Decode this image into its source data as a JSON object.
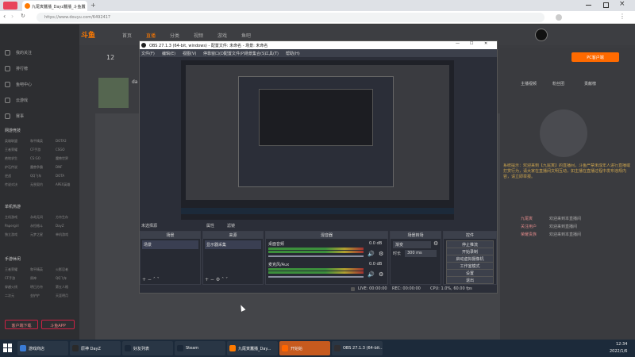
{
  "browser": {
    "tab_title": "九尾寅蠶播_Dayz蠶播_斗鱼蠶",
    "url": "https://www.douyu.com/6492417",
    "new_tab": "+"
  },
  "douyu": {
    "nav": [
      "首页",
      "直播",
      "分类",
      "视频",
      "游戏",
      "鱼吧"
    ],
    "follow_count": "12",
    "streamer_name": "da",
    "sidebar": [
      "我的关注",
      "排行榜",
      "鱼吧中心",
      "云游戏",
      "赛事"
    ],
    "sidebar_section1": "网游竞技",
    "grid1": [
      "英雄联盟",
      "和平精英",
      "DOTA2",
      "王者荣耀",
      "CF手游",
      "CSGO",
      "绝地求生",
      "CS:GO",
      "魔兽世界",
      "炉石传说",
      "魔兽争霸",
      "DNF",
      "逆战",
      "QQ飞车",
      "DOTA",
      "传说对决",
      "无畏契约",
      "APEX英雄"
    ],
    "sidebar_section2": "单机热游",
    "grid2": [
      "主机游戏",
      "永劫无间",
      "方舟生存",
      "Papergirl",
      "永恒格斗",
      "DayZ",
      "独立游戏",
      "元梦之星",
      "单机游戏"
    ],
    "sidebar_section3": "手游休闲",
    "grid3": [
      "王者荣耀",
      "和平精英",
      "火影忍者",
      "CF手游",
      "原神",
      "QQ飞车",
      "穿越火线",
      "明日方舟",
      "第五人格",
      "二次元",
      "金铲铲",
      "天涯明月"
    ],
    "sidebar_bottom": [
      "客户端下载",
      "斗鱼APP"
    ],
    "pc_download": "PC客户端",
    "right_tabs": [
      "主播视频",
      "粉丝团",
      "贡献榜"
    ],
    "chat_notice": "系统提示：欢迎来到【九尾寅】的直播间，斗鱼严禁未成年人进行直播或打赏行为，请大家在直播间文明互动，如主播在直播过程中发布违规内容，请立即举报。",
    "chat_lines": [
      {
        "user": "九尾寅",
        "text": "欢迎来到本直播间"
      },
      {
        "user": "关注用户",
        "text": "欢迎来到直播间"
      },
      {
        "user": "荣耀贵族",
        "text": "欢迎来到本直播间"
      }
    ]
  },
  "obs": {
    "title": "OBS 27.1.3 (64-bit, windows) - 配置文件: 未命名 - 场景: 未命名",
    "menu": [
      "文件(F)",
      "编辑(E)",
      "视图(V)",
      "停靠窗口(D)",
      "配置文件(P)",
      "场景集合(S)",
      "工具(T)",
      "帮助(H)"
    ],
    "source_bar": [
      "未选择源",
      "属性",
      "滤镜"
    ],
    "docks": {
      "scenes": "场景",
      "sources": "来源",
      "mixer": "混音器",
      "transitions": "场景转场",
      "controls": "控件"
    },
    "scene_item": "场景",
    "source_item": "显示器采集",
    "mixer_tracks": [
      {
        "name": "桌面音频",
        "db": "0.0 dB"
      },
      {
        "name": "麦克风/Aux",
        "db": "0.0 dB"
      }
    ],
    "transition_value": "渐变",
    "duration_label": "时长",
    "duration_value": "300 ms",
    "control_buttons": [
      "停止推流",
      "开始录制",
      "启动虚拟摄像机",
      "工作室模式",
      "设置",
      "退出"
    ],
    "status": {
      "live": "LIVE: 00:00:00",
      "rec": "REC: 00:00:00",
      "cpu": "CPU: 1.0%, 60.00 fps"
    }
  },
  "taskbar": {
    "items": [
      {
        "label": "游戏商店",
        "color": "#3a7bd5"
      },
      {
        "label": "原神 DayZ",
        "color": "#2a2a2a"
      },
      {
        "label": "好友列表",
        "color": "#1b2838"
      },
      {
        "label": "Steam",
        "color": "#1b2838"
      },
      {
        "label": "九尾寅蠶播_Day...",
        "color": "#ff7a00"
      },
      {
        "label": "开始始",
        "color": "#ff6600"
      },
      {
        "label": "OBS 27.1.3 (64-bit...",
        "color": "#302e31"
      }
    ],
    "time": "12:34",
    "date": "2022/1/6"
  }
}
